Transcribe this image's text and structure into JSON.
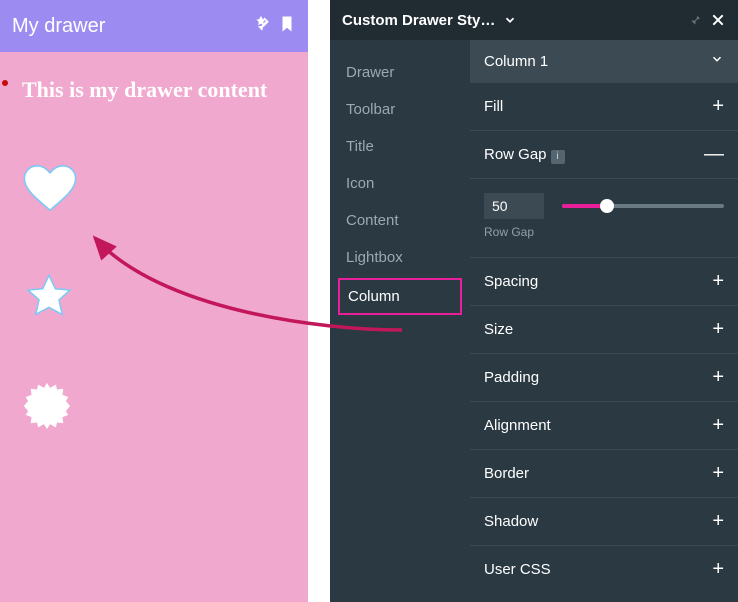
{
  "drawer": {
    "title": "My drawer",
    "content_text": "This is my drawer content"
  },
  "panel": {
    "header_title": "Custom Drawer Sty…",
    "nav": [
      {
        "label": "Drawer"
      },
      {
        "label": "Toolbar"
      },
      {
        "label": "Title"
      },
      {
        "label": "Icon"
      },
      {
        "label": "Content"
      },
      {
        "label": "Lightbox"
      },
      {
        "label": "Column",
        "active": true
      }
    ],
    "column_selector": "Column 1",
    "rowgap": {
      "label": "Row Gap",
      "value": "50",
      "caption": "Row Gap"
    },
    "sections": {
      "fill": "Fill",
      "rowgap": "Row Gap",
      "spacing": "Spacing",
      "size": "Size",
      "padding": "Padding",
      "alignment": "Alignment",
      "border": "Border",
      "shadow": "Shadow",
      "usercss": "User CSS"
    }
  },
  "colors": {
    "accent": "#e91e9b",
    "panel_bg": "#2a3942",
    "header_purple": "#9c8cf2",
    "pink_bg": "#f1a8cf"
  }
}
